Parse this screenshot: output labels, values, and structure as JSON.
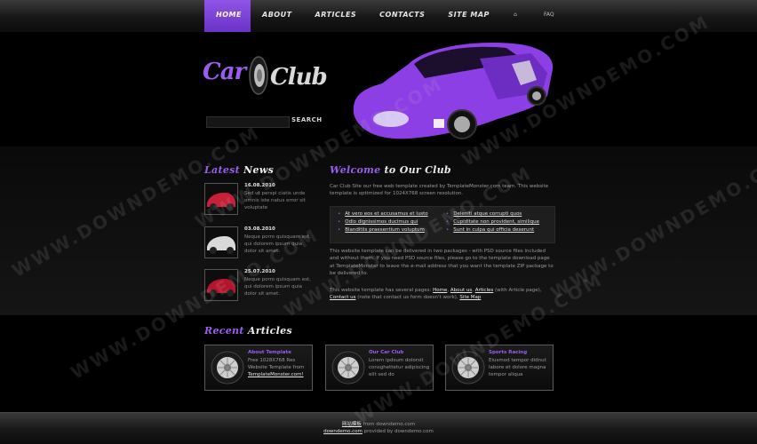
{
  "nav": {
    "items": [
      "HOME",
      "ABOUT",
      "ARTICLES",
      "CONTACTS",
      "SITE MAP"
    ],
    "extra": [
      "FAQ"
    ]
  },
  "logo": {
    "car": "Car",
    "club": "Club"
  },
  "search": {
    "button": "SEARCH"
  },
  "news": {
    "title_a": "Latest",
    "title_b": "News",
    "items": [
      {
        "date": "16.08.2010",
        "text": "Sed ut perspi ciatis unde omnis iste natus error sit voluptate"
      },
      {
        "date": "03.08.2010",
        "text": "Neque porro quisquam est, qui dolorem ipsum quia dolor sit amet."
      },
      {
        "date": "25.07.2010",
        "text": "Neque porro quisquam est, qui dolorem ipsum quia dolor sit amet."
      }
    ]
  },
  "welcome": {
    "title_a": "Welcome",
    "title_b": "to Our Club",
    "p1": "Car Club Site our free web template created by TemplateMonster.com team. This website template is optimized for 1024X768 screen resolution.",
    "links_left": [
      "At vero eos et accusamus et iusto",
      "Odio dignissimos ducimus qui",
      "Blanditiis praesentium voluptum"
    ],
    "links_right": [
      "Deleniti atque corrupti quos",
      "Cupiditate non provident, similique",
      "Sunt in culpa qui officia deserunt"
    ],
    "p2": "This website template can be delivered in two packages - with PSD source files included and without them. If you need PSD source files, please go to the template download page at TemplateMonster to leave the e-mail address that you want the template ZIP package to be delivered to.",
    "p3_a": "This website template has several pages: ",
    "p3_home": "Home",
    "p3_about": "About us",
    "p3_articles": "Articles",
    "p3_b": " (with Article page), ",
    "p3_contacts": "Contact us",
    "p3_c": " (note that contact us form doesn't work), ",
    "p3_sitemap": "Site Map"
  },
  "recent": {
    "title_a": "Recent",
    "title_b": "Articles",
    "items": [
      {
        "title": "About Template",
        "text_a": "Free 1028X768 Res Website Template from ",
        "link": "TemplateMonster.com!"
      },
      {
        "title": "Our Car Club",
        "text_a": "Lorem ipdsum dolorsit consghettetur adipiscing elit sed do",
        "link": ""
      },
      {
        "title": "Sports Racing",
        "text_a": "Eiusmod tempor didnut labore et dolore magna tempor aliqua",
        "link": ""
      }
    ]
  },
  "footer": {
    "l1_link": "网站模板",
    "l1_text": " from downdemo.com",
    "l2_link": "downdemo.com",
    "l2_text": " provided by downdemo.com"
  },
  "watermark": "WWW.DOWNDEMO.COM",
  "colors": {
    "accent": "#9d5cf0",
    "nav_active": "#7a3ed8",
    "background": "#000000"
  },
  "icons": [
    "tire-icon",
    "car-image",
    "wheel-icon"
  ]
}
